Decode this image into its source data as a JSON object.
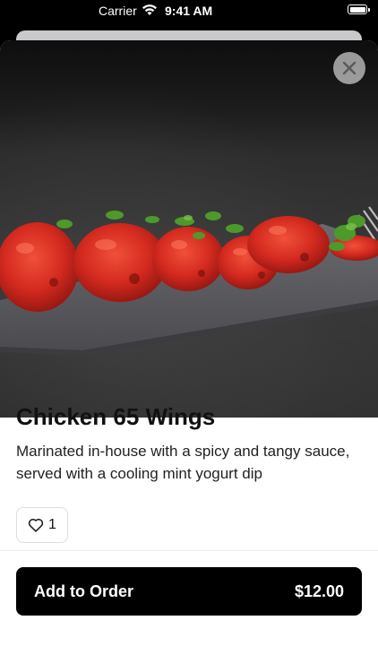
{
  "status_bar": {
    "carrier": "Carrier",
    "time": "9:41 AM",
    "wifi_icon": "wifi-icon",
    "battery_icon": "battery-icon"
  },
  "item": {
    "image_subject": "chicken-wings-photo",
    "title": "Chicken 65 Wings",
    "description": "Marinated in-house with a spicy and tangy sauce, served with a cooling mint yogurt dip",
    "like_count": "1"
  },
  "close_icon": "close-icon",
  "heart_icon": "heart-icon",
  "order_button": {
    "label": "Add to Order",
    "price": "$12.00"
  },
  "colors": {
    "primary_button": "#000000",
    "sauce_red": "#d42a1f",
    "garnish_green": "#4d9a2a"
  }
}
